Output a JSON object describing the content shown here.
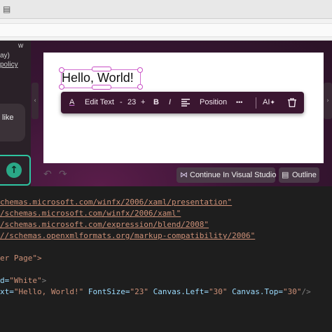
{
  "chrome": {
    "icon": "window-icon"
  },
  "left_panel": {
    "line1": "w",
    "line2": "ay)",
    "line3": "policy",
    "bubble_text": "like",
    "send_icon": "arrow-up-icon"
  },
  "canvas": {
    "text": "Hello, World!"
  },
  "toolbar": {
    "text_color_icon": "A",
    "edit_text": "Edit Text",
    "minus": "-",
    "font_size": "23",
    "plus": "+",
    "bold": "B",
    "italic": "I",
    "align_icon": "align-left-icon",
    "position": "Position",
    "more": "•••",
    "ai": "AI",
    "delete_icon": "trash-icon"
  },
  "actions": {
    "continue_vs": "Continue In Visual Studio",
    "outline": "Outline"
  },
  "code": {
    "line1": "chemas.microsoft.com/winfx/2006/xaml/presentation\"",
    "line2": "/schemas.microsoft.com/winfx/2006/xaml\"",
    "line3": "/schemas.microsoft.com/expression/blend/2008\"",
    "line4": "//schemas.openxmlformats.org/markup-compatibility/2006\"",
    "line5": "er Page\">",
    "line6a": "d=",
    "line6b": "\"White\"",
    "line6c": ">",
    "line7a": "xt=",
    "line7b": "\"Hello, World!\"",
    "line7c": " FontSize=",
    "line7d": "\"23\"",
    "line7e": " Canvas.Left=",
    "line7f": "\"30\"",
    "line7g": " Canvas.Top=",
    "line7h": "\"30\"",
    "line7i": "/>"
  }
}
